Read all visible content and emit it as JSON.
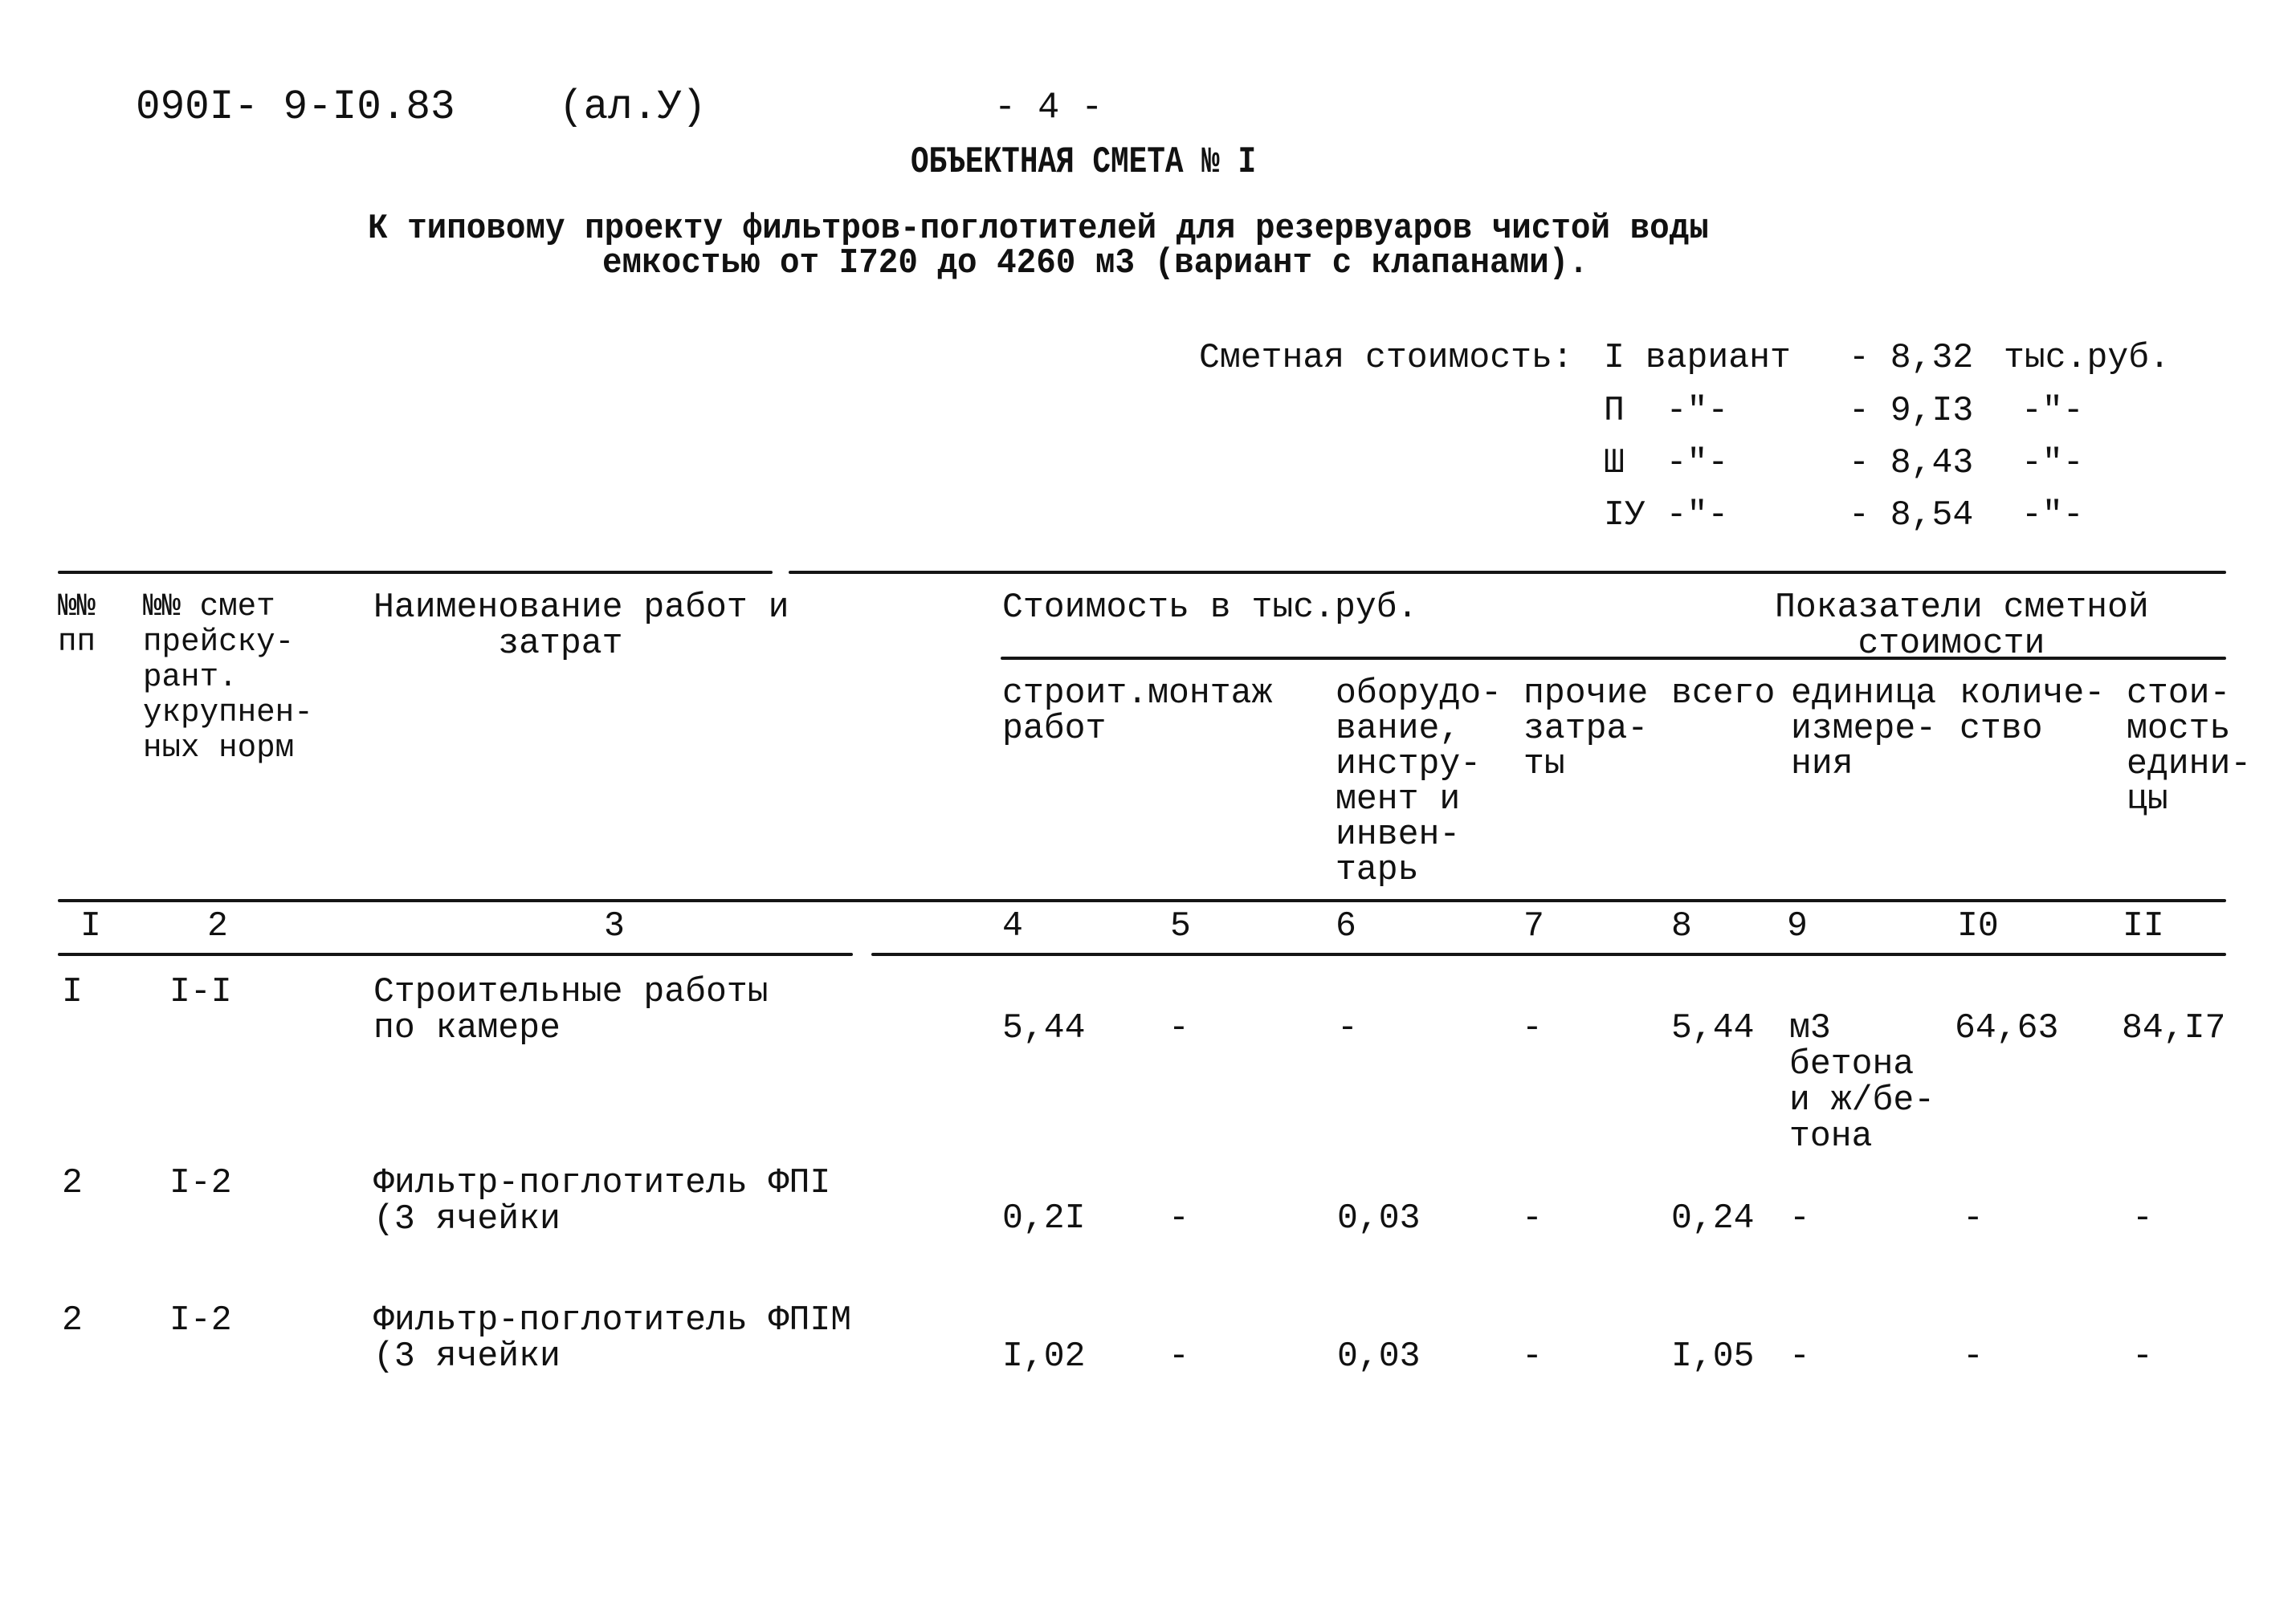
{
  "page_header": {
    "doc_code": "090I- 9-I0.83",
    "album": "(ал.У)",
    "page_number": "- 4 -"
  },
  "title": "ОБЪЕКТНАЯ СМЕТА № I",
  "subtitle": {
    "line1": "К типовому проекту фильтров-поглотителей для резервуаров чистой воды",
    "line2": "емкостью от I720 до 4260 м3 (вариант с клапанами)."
  },
  "estimated_cost": {
    "label": "Сметная стоимость:",
    "variants": [
      {
        "variant": "I вариант",
        "value": "- 8,32",
        "unit": "тыс.руб."
      },
      {
        "variant": "П  -\"-",
        "value": "- 9,I3",
        "unit": "-\"-"
      },
      {
        "variant": "Ш  -\"-",
        "value": "- 8,43",
        "unit": "-\"-"
      },
      {
        "variant": "IУ -\"-",
        "value": "- 8,54",
        "unit": "-\"-"
      }
    ]
  },
  "table": {
    "headers": {
      "col1": "№№\nпп",
      "col2": "№№ смет\nпрейску-\nрант.\nукрупнен-\nных норм",
      "col3": "Наименование работ и\n      затрат",
      "group_cost": "Стоимость в тыс.руб.",
      "group_indicators": "Показатели сметной\n    стоимости",
      "col4_5": "строит.монтаж\nработ",
      "col6": "оборудо-\nвание,\nинстру-\nмент и\nинвен-\nтарь",
      "col7": "прочие\nзатра-\nты",
      "col8": "всего",
      "col9": "единица\nизмере-\nния",
      "col10": "количе-\nство",
      "col11": "стои-\nмость\nедини-\nцы"
    },
    "column_numbers": [
      "I",
      "2",
      "3",
      "4",
      "5",
      "6",
      "7",
      "8",
      "9",
      "I0",
      "II"
    ],
    "rows": [
      {
        "no": "I",
        "ref": "I-I",
        "name": "Строительные работы\nпо камере",
        "construction": "5,44",
        "installation": "-",
        "equipment": "-",
        "other": "-",
        "total": "5,44",
        "unit": "м3\nбетона\nи ж/бе-\nтона",
        "quantity": "64,63",
        "unit_cost": "84,I7"
      },
      {
        "no": "2",
        "ref": "I-2",
        "name": "Фильтр-поглотитель ФПI\n(3 ячейки",
        "construction": "0,2I",
        "installation": "-",
        "equipment": "0,03",
        "other": "-",
        "total": "0,24",
        "unit": "-",
        "quantity": "-",
        "unit_cost": "-"
      },
      {
        "no": "2",
        "ref": "I-2",
        "name": "Фильтр-поглотитель ФПIМ\n(3 ячейки",
        "construction": "I,02",
        "installation": "-",
        "equipment": "0,03",
        "other": "-",
        "total": "I,05",
        "unit": "-",
        "quantity": "-",
        "unit_cost": "-"
      }
    ]
  }
}
